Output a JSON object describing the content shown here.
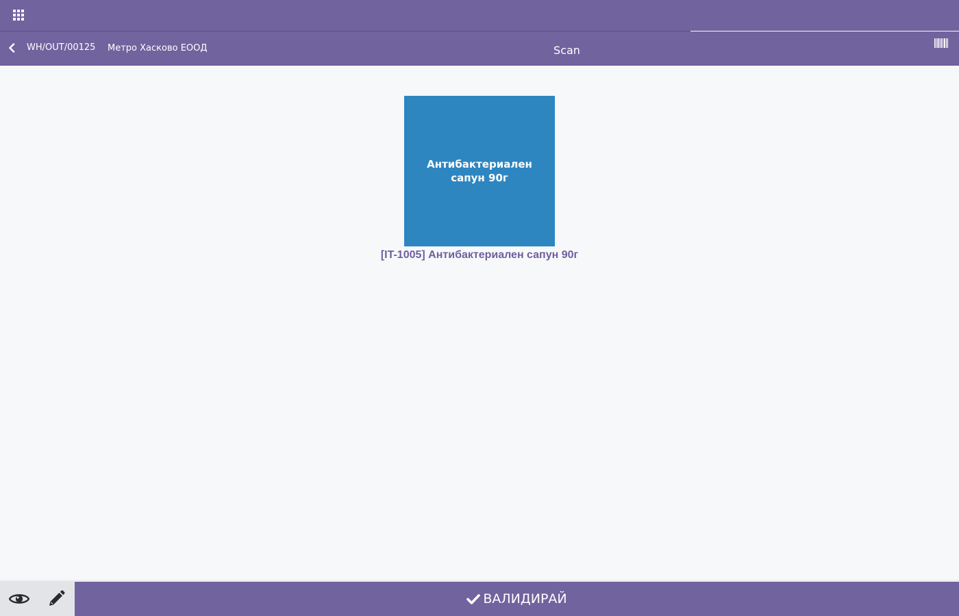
{
  "header": {
    "apps_icon": "apps-grid-icon"
  },
  "subheader": {
    "back_icon": "chevron-left-icon",
    "reference": "WH/OUT/00125",
    "partner": "Метро Хасково ЕООД",
    "title": "Scan",
    "barcode_icon": "barcode-icon"
  },
  "product": {
    "image_text": "Антибактериален сапун 90г",
    "image_color": "#2e86c1",
    "caption": "[IT-1005] Антибактериален сапун 90г"
  },
  "footer": {
    "eye_icon": "eye-icon",
    "edit_icon": "pencil-icon",
    "validate_icon": "check-icon",
    "validate_label": "ВАЛИДИРАЙ"
  },
  "colors": {
    "brand": "#71639e",
    "product_tile": "#2e86c1",
    "background": "#f7f8fa"
  }
}
